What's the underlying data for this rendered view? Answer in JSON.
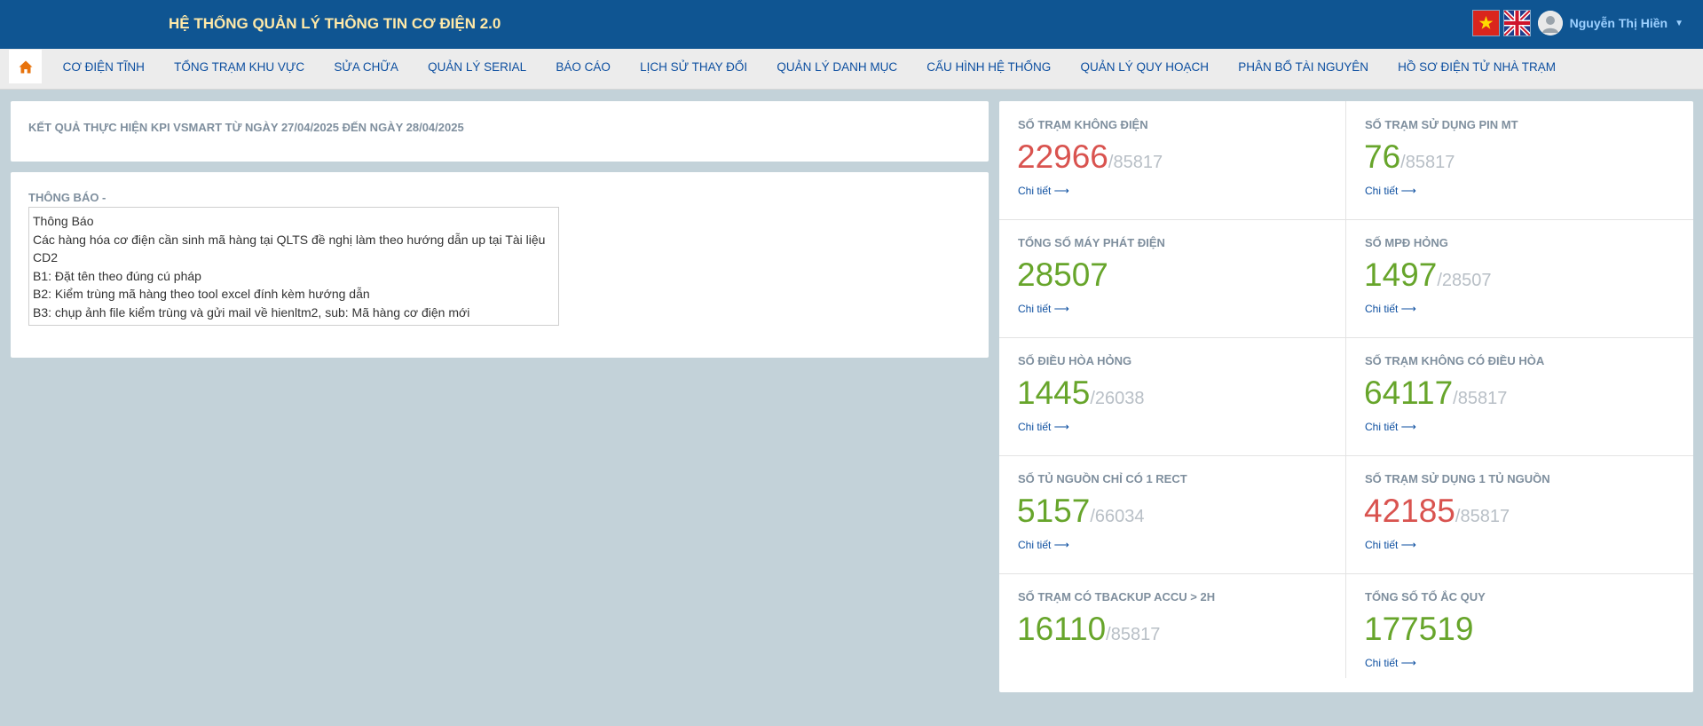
{
  "header": {
    "title": "HỆ THỐNG QUẢN LÝ THÔNG TIN CƠ ĐIỆN 2.0",
    "user_name": "Nguyễn Thị Hiền",
    "flags": [
      "vietnam-flag-icon",
      "uk-flag-icon"
    ]
  },
  "nav": {
    "home_icon": "home-icon",
    "items": [
      "CƠ ĐIỆN TĨNH",
      "TỔNG TRẠM KHU VỰC",
      "SỬA CHỮA",
      "QUẢN LÝ SERIAL",
      "BÁO CÁO",
      "LỊCH SỬ THAY ĐỔI",
      "QUẢN LÝ DANH MỤC",
      "CẤU HÌNH HỆ THỐNG",
      "QUẢN LÝ QUY HOẠCH",
      "PHÂN BỔ TÀI NGUYÊN",
      "HỒ SƠ ĐIỆN TỬ NHÀ TRẠM"
    ]
  },
  "kpi": {
    "title": "KẾT QUẢ THỰC HIỆN KPI VSMART TỪ NGÀY 27/04/2025 ĐẾN NGÀY 28/04/2025"
  },
  "notice": {
    "label": "THÔNG BÁO -",
    "lines": [
      "Thông Báo",
      "Các hàng hóa cơ điện cần sinh mã hàng tại QLTS đề nghị làm theo hướng dẫn up tại Tài liệu CD2",
      "B1: Đặt tên theo đúng cú pháp",
      "B2: Kiểm trùng mã hàng theo tool excel đính kèm hướng dẫn",
      "B3: chụp ảnh file kiểm trùng và gửi mail về hienltm2, sub: Mã hàng cơ điện mới"
    ]
  },
  "colors": {
    "header_bg": "#0f5592",
    "title": "#ffe9a8",
    "good": "#67a52b",
    "bad": "#d9534f",
    "link": "#0d4fa0",
    "page_bg": "#c3d2d9"
  },
  "stats": [
    {
      "label": "SỐ TRẠM KHÔNG ĐIỆN",
      "value": "22966",
      "total": "/85817",
      "color": "red",
      "link": "Chi tiết ⟶"
    },
    {
      "label": "SỐ TRẠM SỬ DỤNG PIN MT",
      "value": "76",
      "total": "/85817",
      "color": "green",
      "link": "Chi tiết ⟶"
    },
    {
      "label": "TỔNG SỐ MÁY PHÁT ĐIỆN",
      "value": "28507",
      "total": "",
      "color": "green",
      "link": "Chi tiết ⟶"
    },
    {
      "label": "SỐ MPĐ HỎNG",
      "value": "1497",
      "total": "/28507",
      "color": "green",
      "link": "Chi tiết ⟶"
    },
    {
      "label": "SỐ ĐIỀU HÒA HỎNG",
      "value": "1445",
      "total": "/26038",
      "color": "green",
      "link": "Chi tiết ⟶"
    },
    {
      "label": "SỐ TRẠM KHÔNG CÓ ĐIỀU HÒA",
      "value": "64117",
      "total": "/85817",
      "color": "green",
      "link": "Chi tiết ⟶"
    },
    {
      "label": "SỐ TỦ NGUỒN CHỈ CÓ 1 RECT",
      "value": "5157",
      "total": "/66034",
      "color": "green",
      "link": "Chi tiết ⟶"
    },
    {
      "label": "SỐ TRẠM SỬ DỤNG 1 TỦ NGUỒN",
      "value": "42185",
      "total": "/85817",
      "color": "red",
      "link": "Chi tiết ⟶"
    },
    {
      "label": "SỐ TRẠM CÓ TBACKUP ACCU > 2H",
      "value": "16110",
      "total": "/85817",
      "color": "green",
      "link": ""
    },
    {
      "label": "TỔNG SỐ TỔ ẮC QUY",
      "value": "177519",
      "total": "",
      "color": "green",
      "link": "Chi tiết ⟶"
    }
  ]
}
